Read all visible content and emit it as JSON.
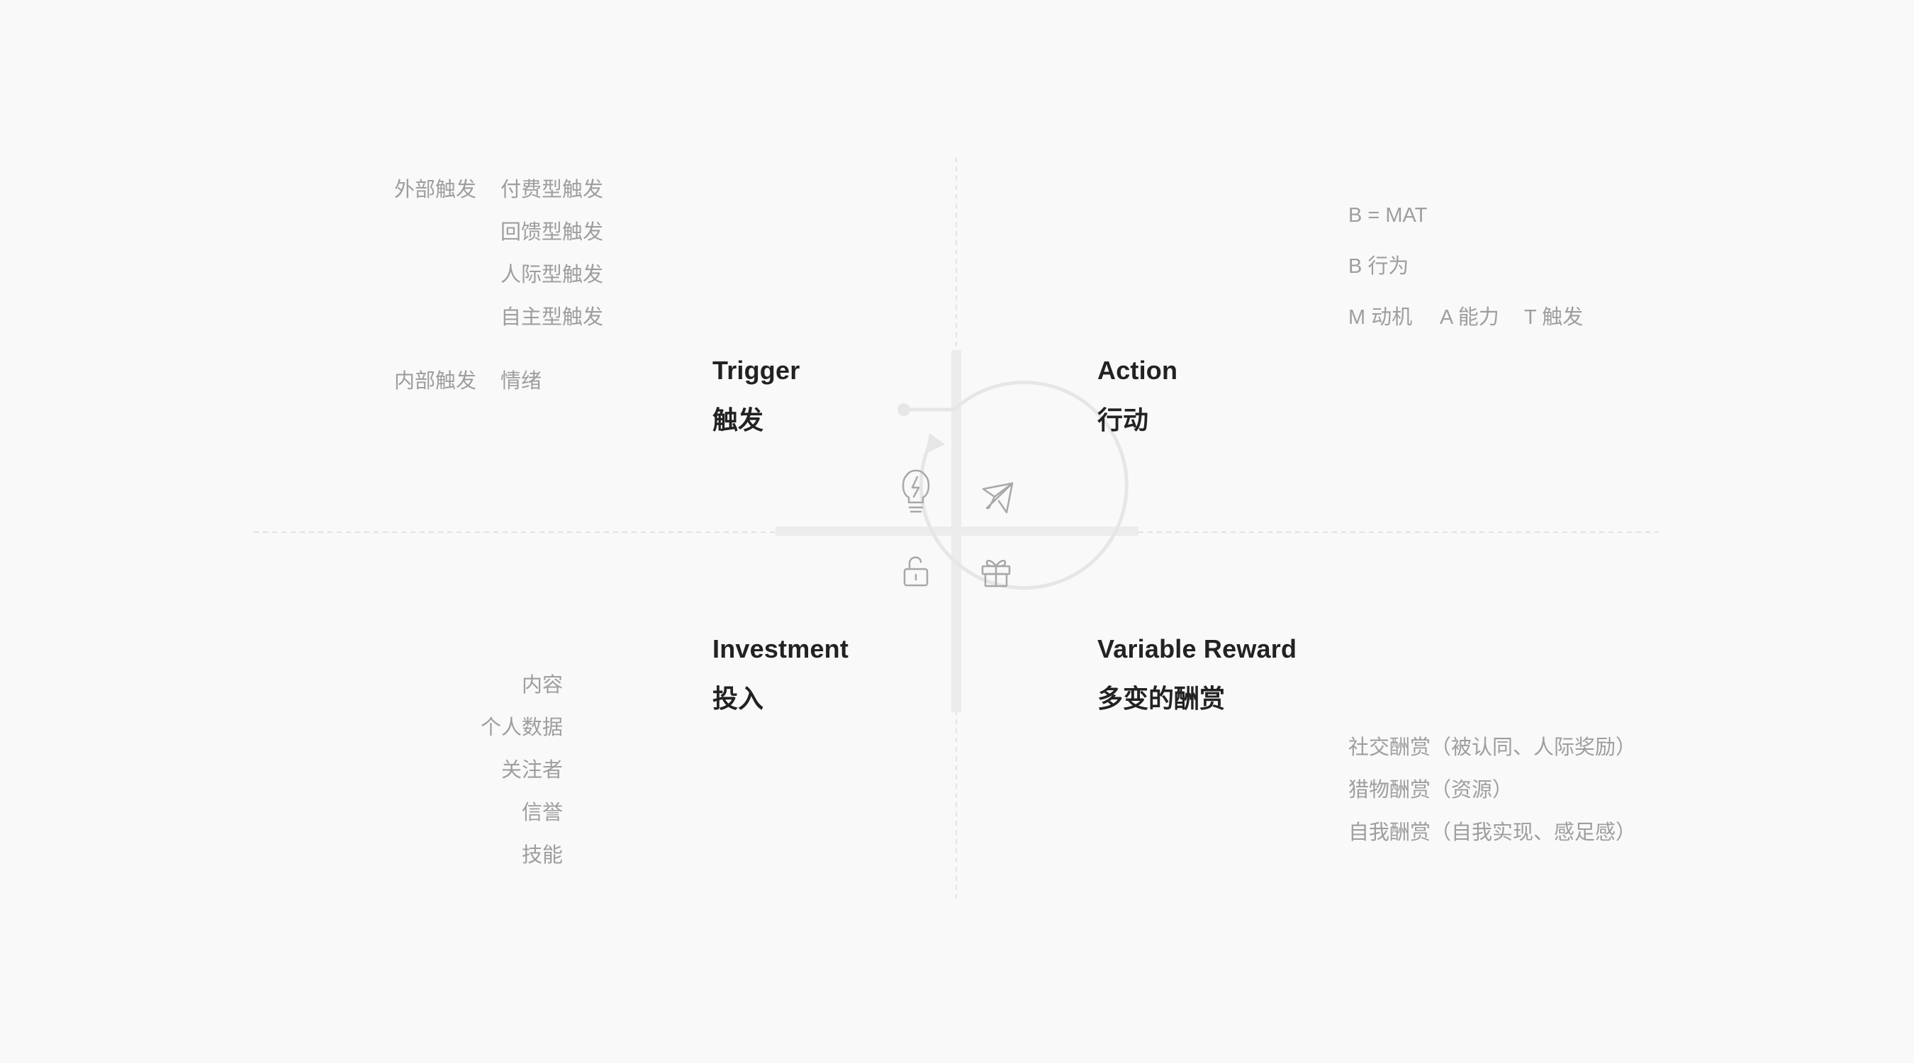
{
  "colors": {
    "background": "#f9f9f9",
    "title": "#222222",
    "note": "#9e9e9e",
    "guide_line": "#e2e2e2",
    "cross": "#ececec",
    "cycle_circle": "#e6e6e6",
    "icon": "#a8a8a8"
  },
  "quadrants": {
    "trigger": {
      "title_en": "Trigger",
      "title_cn": "触发",
      "icon": "lightbulb-icon"
    },
    "action": {
      "title_en": "Action",
      "title_cn": "行动",
      "icon": "rocket-icon"
    },
    "investment": {
      "title_en": "Investment",
      "title_cn": "投入",
      "icon": "lock-icon"
    },
    "reward": {
      "title_en": "Variable Reward",
      "title_cn": "多变的酬赏",
      "icon": "gift-icon"
    }
  },
  "trigger_notes": {
    "external_label": "外部触发",
    "external_items": [
      "付费型触发",
      "回馈型触发",
      "人际型触发",
      "自主型触发"
    ],
    "internal_label": "内部触发",
    "internal_items": [
      "情绪"
    ]
  },
  "action_notes": {
    "formula": "B = MAT",
    "b_meaning": "B 行为",
    "m_meaning": "M 动机",
    "a_meaning": "A 能力",
    "t_meaning": "T 触发"
  },
  "investment_notes": [
    "内容",
    "个人数据",
    "关注者",
    "信誉",
    "技能"
  ],
  "reward_notes": [
    "社交酬赏（被认同、人际奖励）",
    "猎物酬赏（资源）",
    "自我酬赏（自我实现、感足感）"
  ]
}
